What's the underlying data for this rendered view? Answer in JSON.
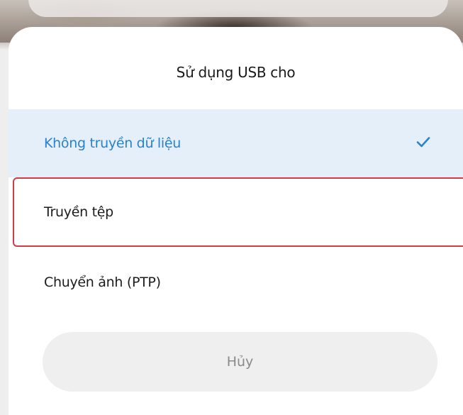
{
  "dialog": {
    "title": "Sử dụng USB cho",
    "options": [
      {
        "label": "Không truyền dữ liệu",
        "selected": true
      },
      {
        "label": "Truyền tệp",
        "selected": false
      },
      {
        "label": "Chuyển ảnh (PTP)",
        "selected": false
      }
    ],
    "cancel_label": "Hủy"
  },
  "colors": {
    "accent": "#2a82c9",
    "selected_background": "#e5eff9",
    "highlight_border": "#d23c48",
    "cancel_background": "#efefef"
  },
  "icons": {
    "selected_marker": "checkmark-icon"
  }
}
